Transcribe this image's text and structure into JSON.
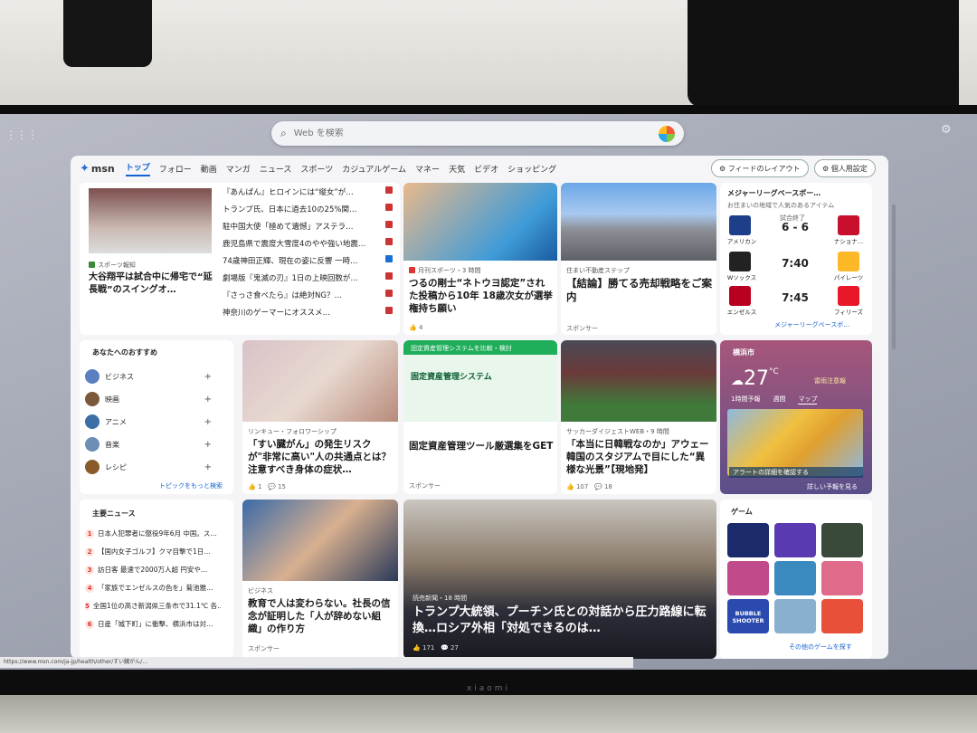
{
  "search": {
    "placeholder": "Web を検索"
  },
  "nav": {
    "logo": "msn",
    "items": [
      "トップ",
      "フォロー",
      "動画",
      "マンガ",
      "ニュース",
      "スポーツ",
      "カジュアルゲーム",
      "マネー",
      "天気",
      "ビデオ",
      "ショッピング"
    ],
    "feed_layout": "フィードのレイアウト",
    "personalize": "個人用設定"
  },
  "headlines": {
    "lead_source": "スポーツ報知",
    "lead_title": "大谷翔平は試合中に帰宅で“延長戦”のスイングオ…",
    "items": [
      "『あんぱん』ヒロインには“縦女”が…",
      "トランプ氏、日本に過去10の25%関…",
      "駐中国大使「極めて遺憾」アステラ…",
      "鹿児島県で震度大雪度4のやや強い地震…",
      "74歳神田正輝、現在の姿に反響 一時…",
      "劇場版『鬼滅の刃』1日の上映回数が…",
      "『さっさ食べたら』は絶対NG？…",
      "神奈川のゲーマーにオススメ…"
    ]
  },
  "article1": {
    "source": "月刊スポーツ・3 時間",
    "title": "つるの剛士“ネトウヨ認定”された投稿から10年 18歳次女が選挙権持ち願い",
    "likes": "4"
  },
  "article2": {
    "source": "住まい不動産ステップ",
    "title": "【結論】勝てる売却戦略をご案内",
    "sponsor": "スポンサー"
  },
  "recommend": {
    "title": "あなたへのおすすめ",
    "topics": [
      "ビジネス",
      "映画",
      "アニメ",
      "音楽",
      "レシピ"
    ],
    "more": "トピックをもっと検索"
  },
  "article3": {
    "source": "リンキュー・フォロワーシップ",
    "title": "「すい臓がん」の発生リスクが\"非常に高い\"人の共通点とは？注意すべき身体の症状…",
    "likes": "1",
    "comments": "15"
  },
  "ad_card": {
    "banner": "固定資産管理システム",
    "banner_top": "固定資産管理システムを比較・検討",
    "title": "固定資産管理ツール厳選集をGET",
    "sponsor": "スポンサー"
  },
  "article4": {
    "source": "サッカーダイジェストWEB・9 時間",
    "title": "「本当に日韓戦なのか」アウェー韓国のスタジアムで目にした“異様な光景”【現地発】",
    "likes": "107",
    "comments": "18"
  },
  "mlb": {
    "title": "メジャーリーグベースボー…",
    "subtitle": "お住まいの地域で人気のあるアイテム",
    "games": [
      {
        "left": "アメリカン",
        "right": "ナショナ…",
        "score": "6 - 6",
        "note": "試合終了"
      },
      {
        "left": "Wソックス",
        "right": "パイレーツ",
        "score": "7:40",
        "note": ""
      },
      {
        "left": "エンゼルス",
        "right": "フィリーズ",
        "score": "7:45",
        "note": ""
      }
    ],
    "more": "メジャーリーグベースボ…"
  },
  "weather": {
    "city": "横浜市",
    "temp": "27",
    "unit": "°C",
    "alert": "雷雨注意報",
    "tabs": [
      "1時間予報",
      "週間",
      "マップ"
    ],
    "alert_bar": "アラートの詳細を確認する",
    "detail": "詳しい予報を見る"
  },
  "top_news": {
    "title": "主要ニュース",
    "items": [
      "日本人犯罪者に懲役9年6月 中国。ス…",
      "【国内女子ゴルフ】クマ目撃で1日…",
      "訪日客 最速で2000万人超 円安や…",
      "「家族でエンゼルスの色を」菊池雅…",
      "全国1位の高さ新潟県三条市で31.1℃ 各…",
      "日産「城下町」に衝撃、横浜市は対…"
    ]
  },
  "article5": {
    "source": "ビジネス",
    "title": "教育で人は変わらない。社長の信念が証明した「人が辞めない組織」の作り方",
    "sponsor": "スポンサー"
  },
  "hero": {
    "source": "読売新聞・18 時間",
    "title": "トランプ大統領、プーチン氏との対話から圧力路線に転換…ロシア外相「対処できるのは…",
    "likes": "171",
    "comments": "27"
  },
  "games": {
    "title": "ゲーム",
    "more": "その他のゲームを探す",
    "game1_label": "BUBBLE SHOOTER"
  },
  "status_url": "https://www.msn.com/ja-jp/health/other/すい臓がん/…",
  "brand": "xiaomi"
}
